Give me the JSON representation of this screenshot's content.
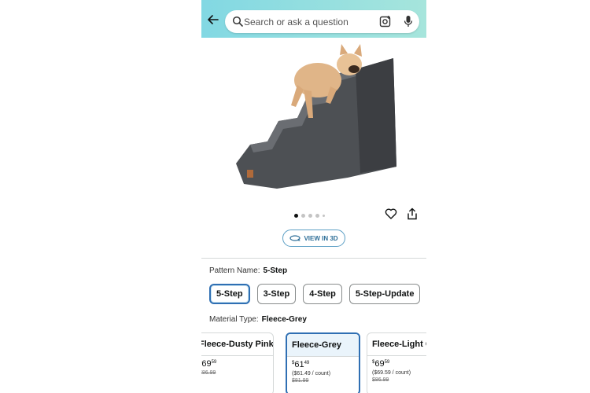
{
  "search": {
    "placeholder": "Search or ask a question"
  },
  "icons": {
    "back": "back-arrow-icon",
    "search": "search-icon",
    "camera": "camera-scan-icon",
    "mic": "microphone-icon",
    "heart": "heart-icon",
    "share": "share-icon",
    "cube": "3d-rotate-icon"
  },
  "gallery": {
    "total_dots": 5,
    "active_index": 0
  },
  "view3d": {
    "label": "VIEW IN 3D"
  },
  "pattern": {
    "label": "Pattern Name:",
    "value": "5-Step",
    "options": [
      "5-Step",
      "3-Step",
      "4-Step",
      "5-Step-Update"
    ],
    "selected_index": 0
  },
  "material": {
    "label": "Material Type:",
    "value": "Fleece-Grey"
  },
  "swatches": [
    {
      "name": "Fleece-Dusty Pink",
      "price_dollars": "69",
      "price_cents": "59",
      "per_count": "",
      "list_price": "$86.99"
    },
    {
      "name": "Fleece-Grey",
      "price_dollars": "61",
      "price_cents": "49",
      "per_count": "($61.49 / count)",
      "list_price": "$81.99"
    },
    {
      "name": "Fleece-Light Grey",
      "price_dollars": "69",
      "price_cents": "59",
      "per_count": "($69.59 / count)",
      "list_price": "$86.99"
    }
  ],
  "colors": {
    "header_start": "#82d8e3",
    "header_end": "#a6e5dc",
    "selected_border": "#2f6fb3",
    "link_blue": "#2f6f98"
  }
}
